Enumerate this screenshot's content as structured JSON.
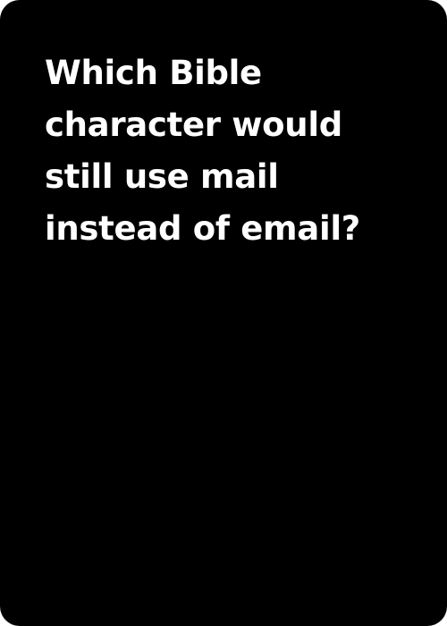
{
  "card": {
    "background_color": "#000000",
    "text_color": "#ffffff",
    "prompt_lines": [
      "Which Bible",
      "character would",
      "still use mail",
      "instead of email?"
    ]
  }
}
